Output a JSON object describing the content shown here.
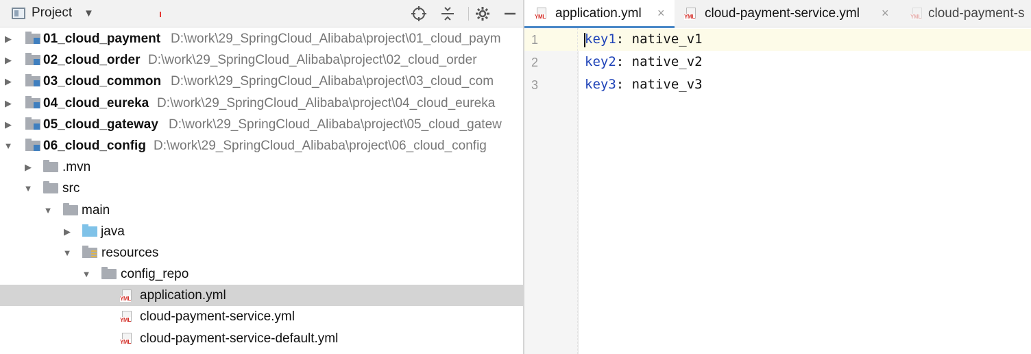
{
  "project_panel": {
    "title": "Project",
    "tools": [
      "locate-icon",
      "collapse-all-icon",
      "gear-icon",
      "minimize-icon"
    ]
  },
  "tree": [
    {
      "label": "01_cloud_payment",
      "path": "D:\\work\\29_SpringCloud_Alibaba\\project\\01_cloud_paym",
      "expanded": false,
      "type": "module",
      "depth": 0
    },
    {
      "label": "02_cloud_order",
      "path": "D:\\work\\29_SpringCloud_Alibaba\\project\\02_cloud_order",
      "expanded": false,
      "type": "module",
      "depth": 0
    },
    {
      "label": "03_cloud_common",
      "path": "D:\\work\\29_SpringCloud_Alibaba\\project\\03_cloud_com",
      "expanded": false,
      "type": "module",
      "depth": 0
    },
    {
      "label": "04_cloud_eureka",
      "path": "D:\\work\\29_SpringCloud_Alibaba\\project\\04_cloud_eureka",
      "expanded": false,
      "type": "module",
      "depth": 0
    },
    {
      "label": "05_cloud_gateway",
      "path": "D:\\work\\29_SpringCloud_Alibaba\\project\\05_cloud_gatew",
      "expanded": false,
      "type": "module",
      "depth": 0
    },
    {
      "label": "06_cloud_config",
      "path": "D:\\work\\29_SpringCloud_Alibaba\\project\\06_cloud_config",
      "expanded": true,
      "type": "module",
      "depth": 0
    },
    {
      "label": ".mvn",
      "expanded": false,
      "type": "folder",
      "depth": 1
    },
    {
      "label": "src",
      "expanded": true,
      "type": "folder",
      "depth": 1
    },
    {
      "label": "main",
      "expanded": true,
      "type": "folder",
      "depth": 2
    },
    {
      "label": "java",
      "expanded": false,
      "type": "source-folder",
      "depth": 3
    },
    {
      "label": "resources",
      "expanded": true,
      "type": "resources-folder",
      "depth": 3
    },
    {
      "label": "config_repo",
      "expanded": true,
      "type": "folder",
      "depth": 4
    },
    {
      "label": "application.yml",
      "type": "yml",
      "depth": 5,
      "selected": true
    },
    {
      "label": "cloud-payment-service.yml",
      "type": "yml",
      "depth": 5
    },
    {
      "label": "cloud-payment-service-default.yml",
      "type": "yml",
      "depth": 5
    }
  ],
  "yml_tag": "YML",
  "editor": {
    "tabs": [
      {
        "label": "application.yml",
        "active": true,
        "close": "×"
      },
      {
        "label": "cloud-payment-service.yml",
        "active": false,
        "close": "×"
      },
      {
        "label": "cloud-payment-s",
        "active": false
      }
    ],
    "lines": [
      {
        "number": "1",
        "key": "key1",
        "value": ": native_v1"
      },
      {
        "number": "2",
        "key": "key2",
        "value": ": native_v2"
      },
      {
        "number": "3",
        "key": "key3",
        "value": ": native_v3"
      }
    ]
  }
}
